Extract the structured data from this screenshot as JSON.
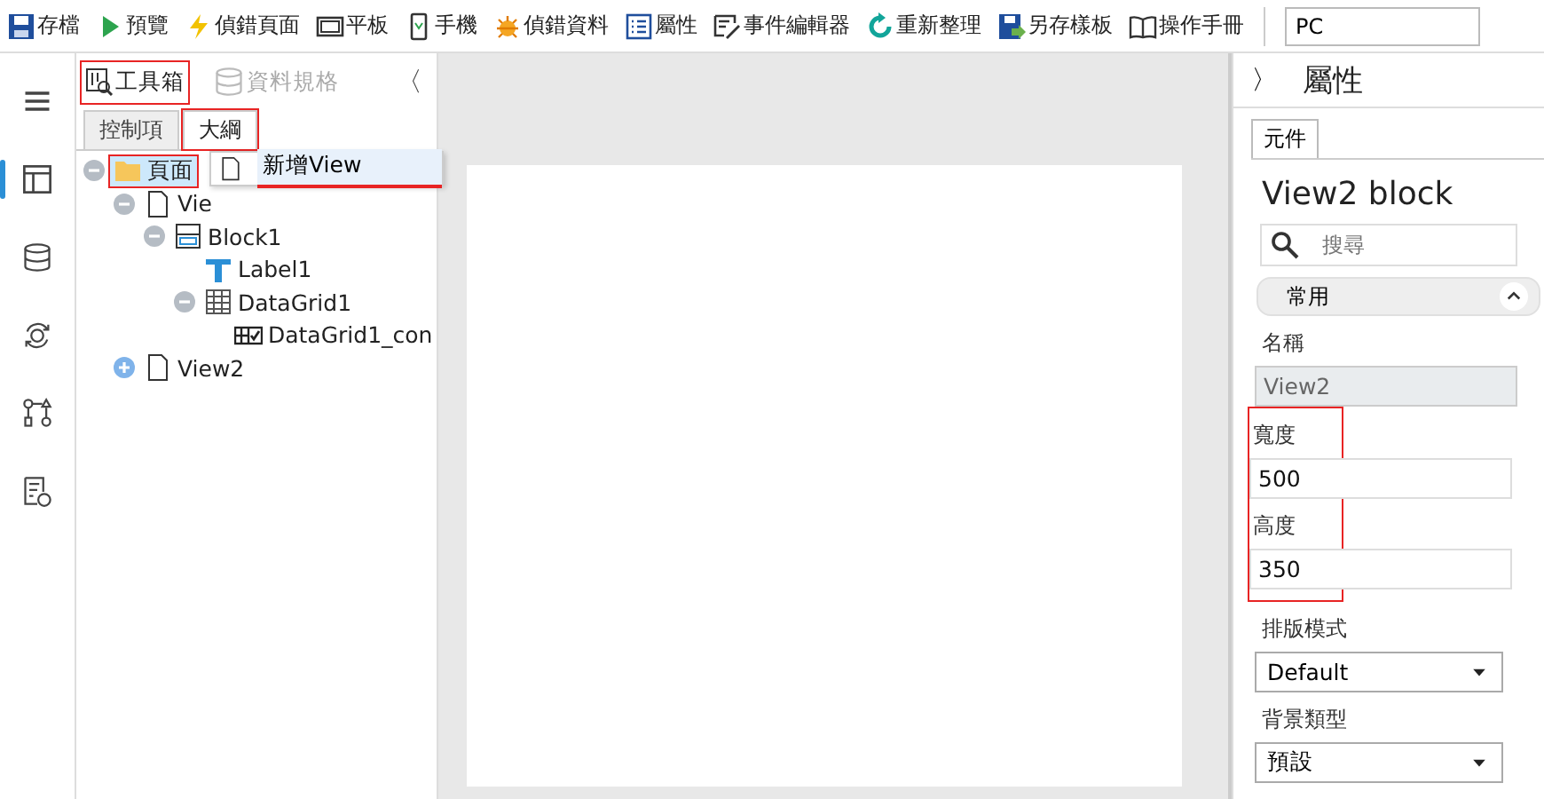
{
  "toolbar": {
    "items": [
      {
        "kind": "save",
        "label": "存檔"
      },
      {
        "kind": "play",
        "label": "預覽"
      },
      {
        "kind": "bolt",
        "label": "偵錯頁面"
      },
      {
        "kind": "tablet",
        "label": "平板"
      },
      {
        "kind": "phone",
        "label": "手機"
      },
      {
        "kind": "bug",
        "label": "偵錯資料"
      },
      {
        "kind": "list",
        "label": "屬性"
      },
      {
        "kind": "edit",
        "label": "事件編輯器"
      },
      {
        "kind": "refresh",
        "label": "重新整理"
      },
      {
        "kind": "saveas",
        "label": "另存樣板"
      },
      {
        "kind": "book",
        "label": "操作手冊"
      }
    ],
    "device_field": {
      "value": "PC"
    }
  },
  "sidebar": {
    "items": [
      {
        "kind": "menu",
        "selected": false
      },
      {
        "kind": "layout",
        "selected": true
      },
      {
        "kind": "database",
        "selected": false
      },
      {
        "kind": "sync",
        "selected": false
      },
      {
        "kind": "flow",
        "selected": false
      },
      {
        "kind": "report",
        "selected": false
      }
    ]
  },
  "left_panel": {
    "tabs": [
      {
        "label": "工具箱",
        "disabled": false,
        "annotated": true
      },
      {
        "label": "資料規格",
        "disabled": true,
        "annotated": false
      }
    ],
    "collapse": "〈",
    "subtabs": [
      {
        "label": "控制項",
        "selected": false,
        "annotated": false
      },
      {
        "label": "大綱",
        "selected": true,
        "annotated": true
      }
    ],
    "tree": [
      {
        "label": "頁面",
        "kind": "folder",
        "expanded": true,
        "selected": true,
        "annotated": true,
        "children": [
          {
            "label": "Vie",
            "kind": "page",
            "expanded": true,
            "selected": false,
            "annotated": false,
            "children": [
              {
                "label": "Block1",
                "kind": "block",
                "expanded": true,
                "selected": false,
                "annotated": false,
                "children": [
                  {
                    "label": "Label1",
                    "kind": "text",
                    "selected": false,
                    "annotated": false
                  },
                  {
                    "label": "DataGrid1",
                    "kind": "grid",
                    "expanded": true,
                    "selected": false,
                    "annotated": false,
                    "children": [
                      {
                        "label": "DataGrid1_con",
                        "kind": "gridcol",
                        "selected": false,
                        "annotated": false
                      }
                    ]
                  }
                ]
              }
            ]
          },
          {
            "label": "View2",
            "kind": "page",
            "expanded": false,
            "selected": false,
            "annotated": false
          }
        ]
      }
    ],
    "context_menu": {
      "items": [
        {
          "label": "新增View",
          "annotated": true
        }
      ]
    }
  },
  "right_panel": {
    "expand": "〉",
    "title": "屬性",
    "tabs": [
      {
        "label": "元件",
        "selected": true
      }
    ],
    "heading": "View2 block",
    "search": {
      "placeholder": "搜尋"
    },
    "section": {
      "label": "常用",
      "expanded": true
    },
    "fields": [
      {
        "kind": "text",
        "label": "名稱",
        "value": "View2",
        "disabled": true,
        "annotated": false
      },
      {
        "kind": "text",
        "label": "寬度",
        "value": "500",
        "disabled": false,
        "annotated": true
      },
      {
        "kind": "text",
        "label": "高度",
        "value": "350",
        "disabled": false,
        "annotated": true
      },
      {
        "kind": "select",
        "label": "排版模式",
        "value": "Default",
        "disabled": false,
        "annotated": false
      },
      {
        "kind": "select",
        "label": "背景類型",
        "value": "預設",
        "disabled": false,
        "annotated": false
      }
    ]
  }
}
